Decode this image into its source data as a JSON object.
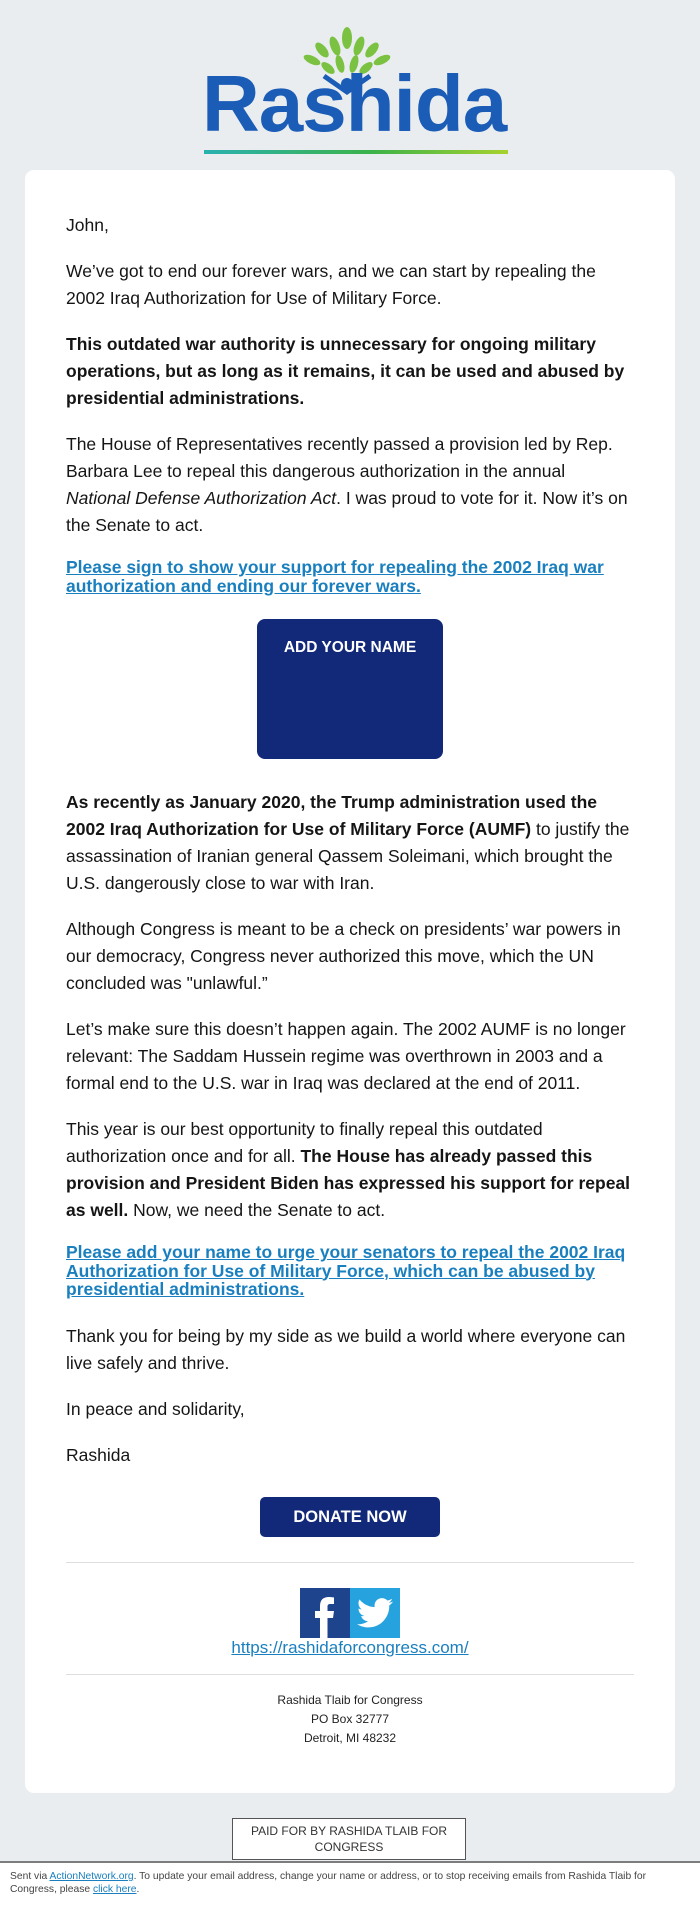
{
  "header": {
    "logo_text": "Rashida",
    "logo_colors": {
      "text": "#1a5cb6",
      "leaf": "#7cc242",
      "bar_start": "#2ab1b0",
      "bar_end": "#a6d22f"
    }
  },
  "email": {
    "greeting": "John,",
    "p1": "We’ve got to end our forever wars, and we can start by repealing the 2002 Iraq Authorization for Use of Military Force.",
    "p2": "This outdated war authority is unnecessary for ongoing military operations, but as long as it remains, it can be used and abused by presidential administrations.",
    "p3": {
      "before": "The House of Representatives recently passed a provision led by Rep. Barbara Lee to repeal this dangerous authorization in the annual ",
      "italic": "National Defense Authorization Act",
      "after": ". I was proud to vote for it. Now it’s on the Senate to act."
    },
    "link1": "Please sign to show your support for repealing the 2002 Iraq war authorization and ending our forever wars.",
    "add_name_button": "ADD YOUR NAME",
    "p4": {
      "bold": "As recently as January 2020, the Trump administration used the 2002 Iraq Authorization for Use of Military Force (AUMF)",
      "after": " to justify the assassination of Iranian general Qassem Soleimani, which brought the U.S. dangerously close to war with Iran."
    },
    "p5": "Although Congress is meant to be a check on presidents’ war powers in our democracy, Congress never authorized this move, which the UN concluded was \"unlawful.”",
    "p6": "Let’s make sure this doesn’t happen again. The 2002 AUMF is no longer relevant: The Saddam Hussein regime was overthrown in 2003 and a formal end to the U.S. war in Iraq was declared at the end of 2011.",
    "p7": {
      "before": "This year is our best opportunity to finally repeal this outdated authorization once and for all. ",
      "bold": "The House has already passed this provision and President Biden has expressed his support for repeal as well.",
      "after": " Now, we need the Senate to act."
    },
    "link2": "Please add your name to urge your senators to repeal the 2002 Iraq Authorization for Use of Military Force, which can be abused by presidential administrations.",
    "p8": "Thank you for being by my side as we build a world where everyone can live safely and thrive.",
    "closing": "In peace and solidarity,",
    "signature": "Rashida",
    "donate_button": "DONATE NOW",
    "accent_color": "#12297a",
    "link_color": "#1a7fbe"
  },
  "social": {
    "facebook_icon": "facebook-icon",
    "twitter_icon": "twitter-icon",
    "website": "https://rashidaforcongress.com/"
  },
  "address": {
    "line1": "Rashida Tlaib for Congress",
    "line2": "PO Box 32777",
    "line3": "Detroit, MI 48232"
  },
  "disclaimer": "PAID FOR BY RASHIDA TLAIB FOR CONGRESS",
  "footer": {
    "sent_via": "Sent via ",
    "network_link": "ActionNetwork.org",
    "middle": ". To update your email address, change your name or address, or to stop receiving emails from Rashida Tlaib for Congress, please ",
    "click_here": "click here",
    "end": "."
  }
}
